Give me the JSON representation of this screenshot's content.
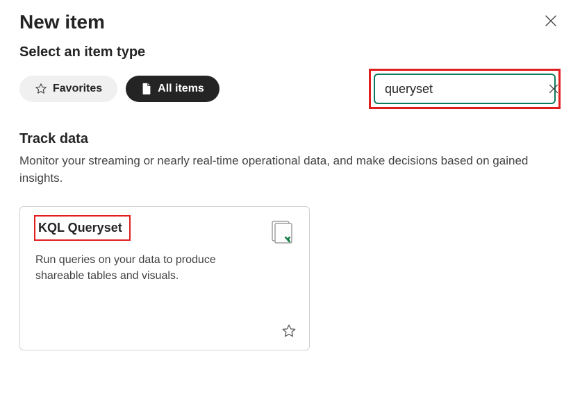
{
  "header": {
    "title": "New item"
  },
  "subtitle": "Select an item type",
  "filters": {
    "favorites_label": "Favorites",
    "allitems_label": "All items"
  },
  "search": {
    "value": "queryset",
    "placeholder": ""
  },
  "section": {
    "title": "Track data",
    "description": "Monitor your streaming or nearly real-time operational data, and make decisions based on gained insights."
  },
  "card": {
    "title": "KQL Queryset",
    "description": "Run queries on your data to produce shareable tables and visuals."
  }
}
